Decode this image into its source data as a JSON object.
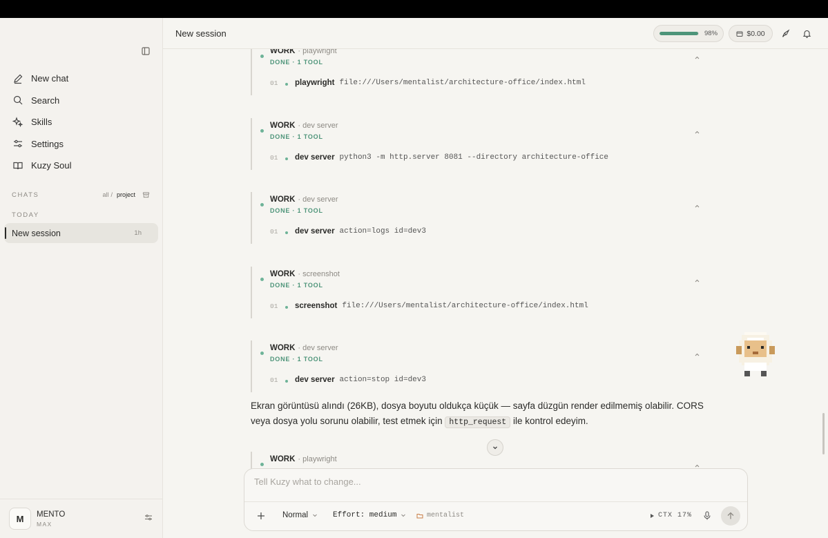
{
  "sidebar": {
    "nav": [
      {
        "label": "New chat",
        "icon": "pencil-icon"
      },
      {
        "label": "Search",
        "icon": "search-icon"
      },
      {
        "label": "Skills",
        "icon": "sparkle-icon"
      },
      {
        "label": "Settings",
        "icon": "sliders-icon"
      },
      {
        "label": "Kuzy Soul",
        "icon": "book-icon"
      }
    ],
    "chats_label": "CHATS",
    "filter": {
      "all": "all",
      "separator": "/",
      "project": "project"
    },
    "today_label": "TODAY",
    "sessions": [
      {
        "label": "New session",
        "time": "1h"
      }
    ],
    "user": {
      "initial": "M",
      "name": "MENTO",
      "plan": "MAX"
    }
  },
  "header": {
    "title": "New session",
    "usage_percent": 98,
    "usage_label": "98%",
    "cost": "$0.00"
  },
  "work_blocks": [
    {
      "label": "WORK",
      "subtitle": "· playwright",
      "status": "DONE · 1 TOOL",
      "tool": {
        "num": "01",
        "name": "playwright",
        "args": "file:///Users/mentalist/architecture-office/index.html"
      }
    },
    {
      "label": "WORK",
      "subtitle": "· dev server",
      "status": "DONE · 1 TOOL",
      "tool": {
        "num": "01",
        "name": "dev server",
        "args": "python3 -m http.server 8081 --directory architecture-office"
      }
    },
    {
      "label": "WORK",
      "subtitle": "· dev server",
      "status": "DONE · 1 TOOL",
      "tool": {
        "num": "01",
        "name": "dev server",
        "args": "action=logs id=dev3"
      }
    },
    {
      "label": "WORK",
      "subtitle": "· screenshot",
      "status": "DONE · 1 TOOL",
      "tool": {
        "num": "01",
        "name": "screenshot",
        "args": "file:///Users/mentalist/architecture-office/index.html"
      }
    },
    {
      "label": "WORK",
      "subtitle": "· dev server",
      "status": "DONE · 1 TOOL",
      "tool": {
        "num": "01",
        "name": "dev server",
        "args": "action=stop id=dev3"
      }
    }
  ],
  "message": {
    "text_before": "Ekran görüntüsü alındı (26KB), dosya boyutu oldukça küçük — sayfa düzgün render edilmemiş olabilir. CORS veya dosya yolu sorunu olabilir, test etmek için ",
    "code": "http_request",
    "text_after": " ile kontrol edeyim."
  },
  "partial_block": {
    "label": "WORK",
    "subtitle": "· playwright"
  },
  "composer": {
    "placeholder": "Tell Kuzy what to change...",
    "mode": "Normal",
    "effort": "Effort: medium",
    "folder": "mentalist",
    "ctx": "CTX 17%"
  },
  "colors": {
    "accent": "#4d9479",
    "dot": "#6eb398",
    "background": "#f6f5f1",
    "sidebar": "#f4f2ee"
  }
}
